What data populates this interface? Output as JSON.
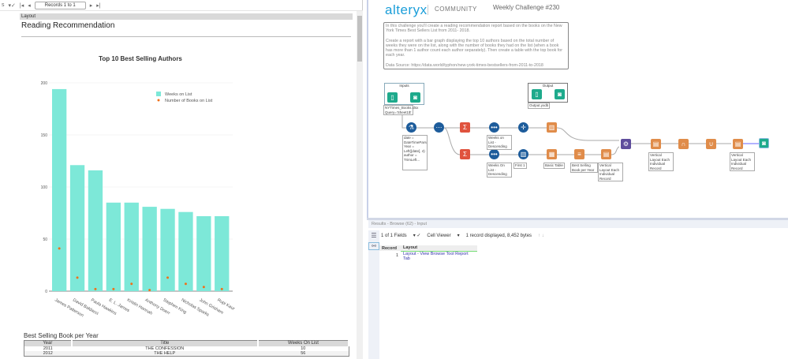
{
  "left_panel": {
    "toolbar": {
      "fields_menu": "s",
      "records": "Records 1 to 1"
    },
    "layout_header": "Layout",
    "report_title": "Reading Recommendation",
    "table_title": "Best Selling Book per Year",
    "table": {
      "columns": [
        "Year",
        "Title",
        "Weeks On List"
      ],
      "rows": [
        [
          "2011",
          "THE CONFESSION",
          "10"
        ],
        [
          "2012",
          "THE HELP",
          "56"
        ]
      ]
    }
  },
  "chart_data": {
    "type": "bar",
    "title": "Top 10 Best Selling Authors",
    "categories": [
      "James Patterson",
      "David Baldacci",
      "Paula Hawkins",
      "E. L. James",
      "Kristin Hannah",
      "Anthony Doerr",
      "Stephen King",
      "Nicholas Sparks",
      "John Grisham",
      "Rupi Kaur"
    ],
    "series": [
      {
        "name": "Weeks on List",
        "type": "bar",
        "color": "#7de8d8",
        "values": [
          194,
          121,
          116,
          85,
          85,
          81,
          79,
          76,
          72,
          72
        ]
      },
      {
        "name": "Number of Books on List",
        "type": "scatter",
        "color": "#f0701a",
        "values": [
          41,
          13,
          2,
          2,
          7,
          1,
          13,
          7,
          4,
          2
        ]
      }
    ],
    "yticks": [
      0,
      50,
      100,
      150,
      200
    ],
    "ylim": [
      0,
      200
    ],
    "legend": "top-right"
  },
  "right_panel": {
    "logo": "alteryx",
    "community": "COMMUNITY",
    "challenge": "Weekly Challenge #230",
    "description": [
      "In this challenge you'll create a reading recommendation report based on the books on the New York Times Best Sellers List from 2011- 2018.",
      "Create a report with a bar graph displaying the top 10 authors based on the total number of weeks they were on the list, along with the number of books they had on the list (when a book has more than 1 author count each author separately). Then create a table with the top book for each year.",
      "Data Source: https://data.world/typhon/new-york-times-bestsellers-from-2011-to-2018"
    ],
    "containers": {
      "inputs": "Inputs",
      "output": "Output"
    },
    "annotations": {
      "input": "NYTimes_Books.xlsx Query='Sheet1$'",
      "output": "Output.yxdb",
      "formula": "date = DateTimeParse([date],\"%m/%d/%y\") Year = Left([date], 4) author = TrimLeft...",
      "sort1": "Weeks on List - Descending",
      "sort2": "Weeks On List - Descending",
      "sample": "First 1",
      "table": "Basic Table",
      "text": "Best Selling Book per Year",
      "layout1": "Vertical Layout Each Individual Record",
      "layout2": "Vertical Layout Each Individual Record",
      "layout3": "Vertical Layout Each Individual Record"
    }
  },
  "results": {
    "header": "Results - Browse (62) - Input",
    "fields": "1 of 1 Fields",
    "viewer": "Cell Viewer",
    "summary": "1 record displayed, 8,452 bytes",
    "columns": [
      "Record",
      "Layout"
    ],
    "row": {
      "num": "1",
      "value": "Layout - View Browse Tool Report Tab"
    }
  }
}
